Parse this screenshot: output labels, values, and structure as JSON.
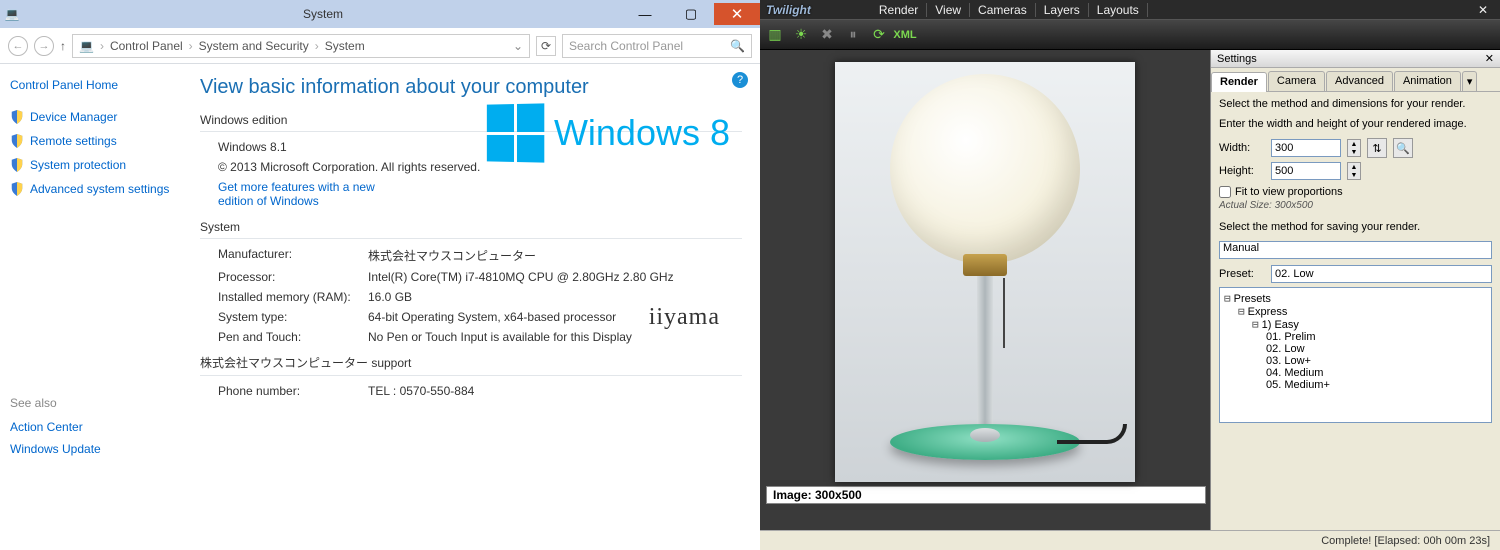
{
  "win": {
    "title": "System",
    "breadcrumb": [
      "Control Panel",
      "System and Security",
      "System"
    ],
    "search_placeholder": "Search Control Panel",
    "help_icon": "?",
    "sidebar": {
      "home": "Control Panel Home",
      "links": [
        "Device Manager",
        "Remote settings",
        "System protection",
        "Advanced system settings"
      ],
      "seealso_label": "See also",
      "seealso": [
        "Action Center",
        "Windows Update"
      ]
    },
    "main": {
      "heading": "View basic information about your computer",
      "edition_header": "Windows edition",
      "edition_name": "Windows 8.1",
      "copyright": "© 2013 Microsoft Corporation. All rights reserved.",
      "features_link": "Get more features with a new edition of Windows",
      "logo_text": "Windows 8",
      "system_header": "System",
      "rows": {
        "manufacturer_k": "Manufacturer:",
        "manufacturer_v": "株式会社マウスコンピューター",
        "processor_k": "Processor:",
        "processor_v": "Intel(R) Core(TM) i7-4810MQ CPU @ 2.80GHz   2.80 GHz",
        "ram_k": "Installed memory (RAM):",
        "ram_v": "16.0 GB",
        "type_k": "System type:",
        "type_v": "64-bit Operating System, x64-based processor",
        "pen_k": "Pen and Touch:",
        "pen_v": "No Pen or Touch Input is available for this Display"
      },
      "oem_logo": "iiyama",
      "support_header": "株式会社マウスコンピューター support",
      "phone_k": "Phone number:",
      "phone_v": "TEL : 0570-550-884"
    }
  },
  "tw": {
    "brand": "Twilight",
    "menu": [
      "Render",
      "View",
      "Cameras",
      "Layers",
      "Layouts"
    ],
    "tool_icons": [
      "film",
      "sun",
      "x",
      "bars",
      "circle",
      "xml"
    ],
    "settings_title": "Settings",
    "tabs": [
      "Render",
      "Camera",
      "Advanced",
      "Animation"
    ],
    "active_tab": "Render",
    "text1": "Select the method and dimensions for your render.",
    "text2": "Enter the width and height of your rendered image.",
    "width_label": "Width:",
    "width_value": "300",
    "height_label": "Height:",
    "height_value": "500",
    "fit_label": "Fit to view proportions",
    "actual_label": "Actual Size: 300x500",
    "text3": "Select the method for saving your render.",
    "save_method": "Manual",
    "preset_label": "Preset:",
    "preset_value": "02. Low",
    "tree": {
      "root": "Presets",
      "n1": "Express",
      "n2": "1) Easy",
      "leaves": [
        "01. Prelim",
        "02. Low",
        "03. Low+",
        "04. Medium",
        "05. Medium+"
      ]
    },
    "image_label": "Image: 300x500",
    "status": "Complete!  [Elapsed: 00h 00m 23s]"
  }
}
